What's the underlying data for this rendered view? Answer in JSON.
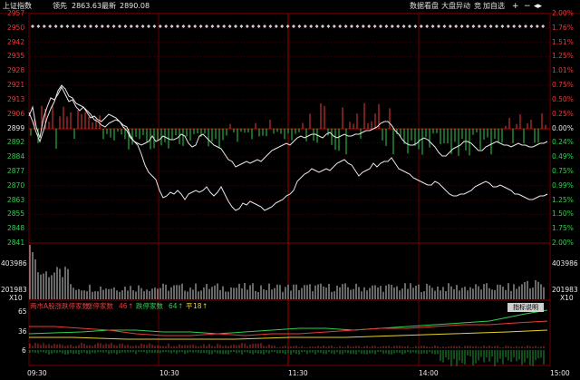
{
  "header": {
    "index_name": "上证指数",
    "lead_label": "领先",
    "price_1": "2863.63",
    "latest_label": "最新",
    "price_2": "2890.08"
  },
  "toolbar": {
    "data_view": "数据看盘",
    "market_alert": "大盘异动",
    "market": "竞",
    "add_watch": "加自选",
    "zoom_in_icon": "plus-icon",
    "zoom_out_icon": "minus-icon",
    "arrows_icon": "double-arrow-icon"
  },
  "price_axis_left": [
    "2957",
    "2950",
    "2942",
    "2935",
    "2928",
    "2921",
    "2913",
    "2906",
    "2899",
    "2892",
    "2884",
    "2877",
    "2870",
    "2863",
    "2855",
    "2848",
    "2841"
  ],
  "pct_axis_right": [
    "2.00%",
    "1.76%",
    "1.51%",
    "1.25%",
    "1.01%",
    "0.75%",
    "0.50%",
    "0.25%",
    "0.00%",
    "0.24%",
    "0.49%",
    "0.75%",
    "0.99%",
    "1.25%",
    "1.50%",
    "1.75%",
    "2.00%"
  ],
  "volume_axis": {
    "left_top": "403986",
    "left_mid": "201983",
    "left_unit": "X10",
    "right_top": "403986",
    "right_mid": "201983",
    "right_unit": "X10"
  },
  "indicator": {
    "title": "两市A股涨跌停家数",
    "up_limit_label": "涨停家数",
    "up_limit_value": "46",
    "down_limit_label": "跌停家数",
    "down_limit_value": "64",
    "flat_label": "平",
    "flat_value": "18",
    "help_button": "指标说明",
    "axis_top": "65",
    "axis_mid": "36",
    "axis_low": "6"
  },
  "time_axis": [
    "09:30",
    "10:30",
    "11:30",
    "14:00",
    "15:00"
  ],
  "colors": {
    "grid_red": "#6b0000",
    "axis_red": "#e83b3b",
    "axis_green": "#2fd14f",
    "line_white": "#e8e8e8",
    "line_yellow": "#e6d22a"
  }
}
